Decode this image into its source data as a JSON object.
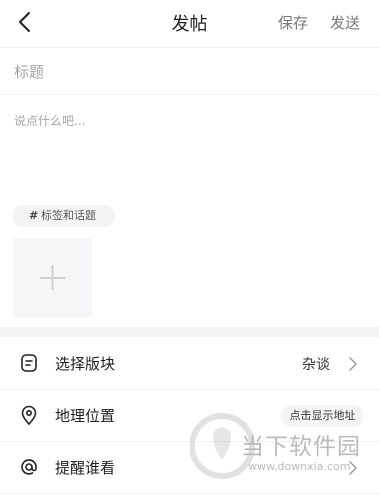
{
  "header": {
    "title": "发帖",
    "save_label": "保存",
    "send_label": "发送"
  },
  "icons": {
    "back": "chevron-left-icon",
    "add_image": "plus-icon",
    "section": "document-list-icon",
    "location": "location-pin-icon",
    "mention": "at-sign-icon",
    "chevron": "chevron-right-icon"
  },
  "editor": {
    "title_placeholder": "标题",
    "content_placeholder": "说点什么吧...",
    "tag_hash": "#",
    "tag_label": "标签和话题"
  },
  "options": {
    "section": {
      "label": "选择版块",
      "value": "杂谈"
    },
    "location": {
      "label": "地理位置",
      "action": "点击显示地址"
    },
    "mention": {
      "label": "提醒谁看"
    }
  },
  "watermark": {
    "text_cn": "当下软件园",
    "url": "www.downxia.com"
  },
  "colors": {
    "text_primary": "#222222",
    "text_secondary": "#777777",
    "placeholder": "#a6a6a6",
    "pill_bg": "#f4f4f4",
    "divider": "#efefef"
  }
}
